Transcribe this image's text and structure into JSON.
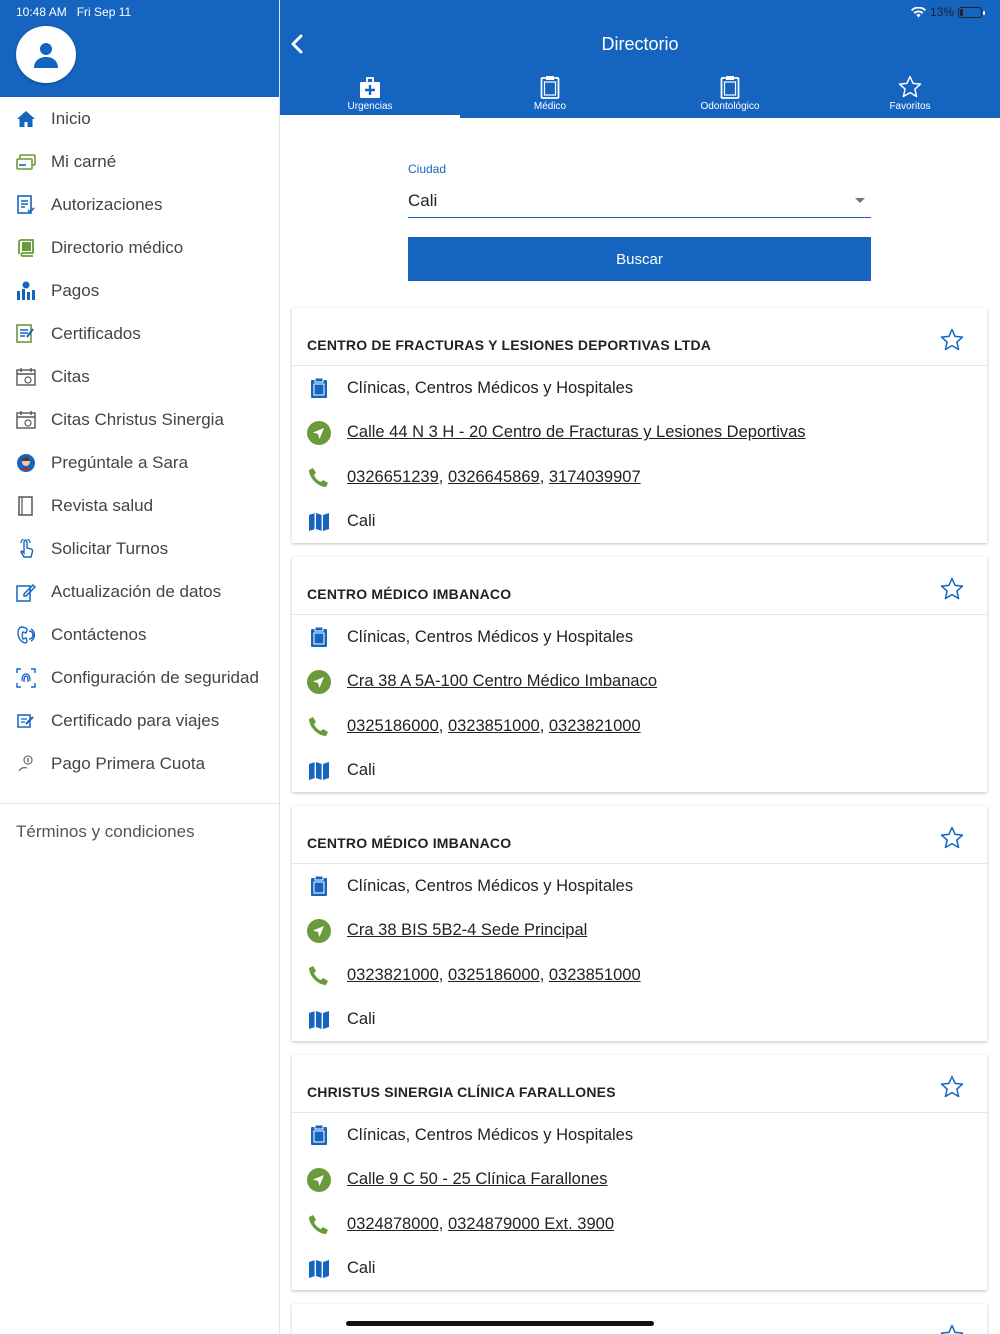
{
  "status_bar": {
    "time": "10:48 AM",
    "date": "Fri Sep 11",
    "battery": "13%",
    "battery_level": 0.13
  },
  "colors": {
    "brand": "#1565c0",
    "green": "#6a9a3a",
    "text": "#222222"
  },
  "sidebar": {
    "avatar_icon": "user-icon",
    "items": [
      {
        "label": "Inicio",
        "icon": "home-icon"
      },
      {
        "label": "Mi carné",
        "icon": "card-icon"
      },
      {
        "label": "Autorizaciones",
        "icon": "document-check-icon"
      },
      {
        "label": "Directorio médico",
        "icon": "book-icon"
      },
      {
        "label": "Pagos",
        "icon": "payments-icon"
      },
      {
        "label": "Certificados",
        "icon": "certificate-icon"
      },
      {
        "label": "Citas",
        "icon": "calendar-icon"
      },
      {
        "label": "Citas Christus Sinergia",
        "icon": "calendar-icon"
      },
      {
        "label": "Pregúntale a Sara",
        "icon": "assistant-icon"
      },
      {
        "label": "Revista salud",
        "icon": "magazine-icon"
      },
      {
        "label": "Solicitar Turnos",
        "icon": "touch-icon"
      },
      {
        "label": "Actualización de datos",
        "icon": "edit-icon"
      },
      {
        "label": "Contáctenos",
        "icon": "phone-icon"
      },
      {
        "label": "Configuración de seguridad",
        "icon": "fingerprint-icon"
      },
      {
        "label": "Certificado para viajes",
        "icon": "travel-certificate-icon"
      },
      {
        "label": "Pago Primera Cuota",
        "icon": "coin-icon"
      }
    ],
    "terms": "Términos y condiciones"
  },
  "header": {
    "title": "Directorio",
    "tabs": [
      {
        "label": "Urgencias",
        "icon": "medical-kit-icon"
      },
      {
        "label": "Médico",
        "icon": "clipboard-icon"
      },
      {
        "label": "Odontológico",
        "icon": "clipboard-icon"
      },
      {
        "label": "Favoritos",
        "icon": "star-icon"
      }
    ],
    "active_tab": "Urgencias"
  },
  "form": {
    "city_label": "Ciudad",
    "city_value": "Cali",
    "search_label": "Buscar"
  },
  "results": [
    {
      "name": "CENTRO DE FRACTURAS Y LESIONES DEPORTIVAS LTDA",
      "category": "Clínicas, Centros Médicos y Hospitales",
      "address": "Calle 44 N 3 H - 20 Centro de Fracturas y Lesiones Deportivas",
      "phones": [
        "0326651239",
        "0326645869",
        "3174039907"
      ],
      "city": "Cali"
    },
    {
      "name": "CENTRO MÉDICO IMBANACO",
      "category": "Clínicas, Centros Médicos y Hospitales",
      "address": "Cra 38 A 5A-100 Centro Médico Imbanaco",
      "phones": [
        "0325186000",
        "0323851000",
        "0323821000"
      ],
      "city": "Cali"
    },
    {
      "name": "CENTRO MÉDICO IMBANACO",
      "category": "Clínicas, Centros Médicos y Hospitales",
      "address": "Cra 38 BIS 5B2-4 Sede Principal",
      "phones": [
        "0323821000",
        "0325186000",
        "0323851000"
      ],
      "city": "Cali"
    },
    {
      "name": "CHRISTUS SINERGIA CLÍNICA FARALLONES",
      "category": "Clínicas, Centros Médicos y Hospitales",
      "address": "Calle 9 C 50 - 25 Clínica Farallones",
      "phones": [
        "0324878000",
        "0324879000 Ext. 3900"
      ],
      "city": "Cali"
    }
  ]
}
